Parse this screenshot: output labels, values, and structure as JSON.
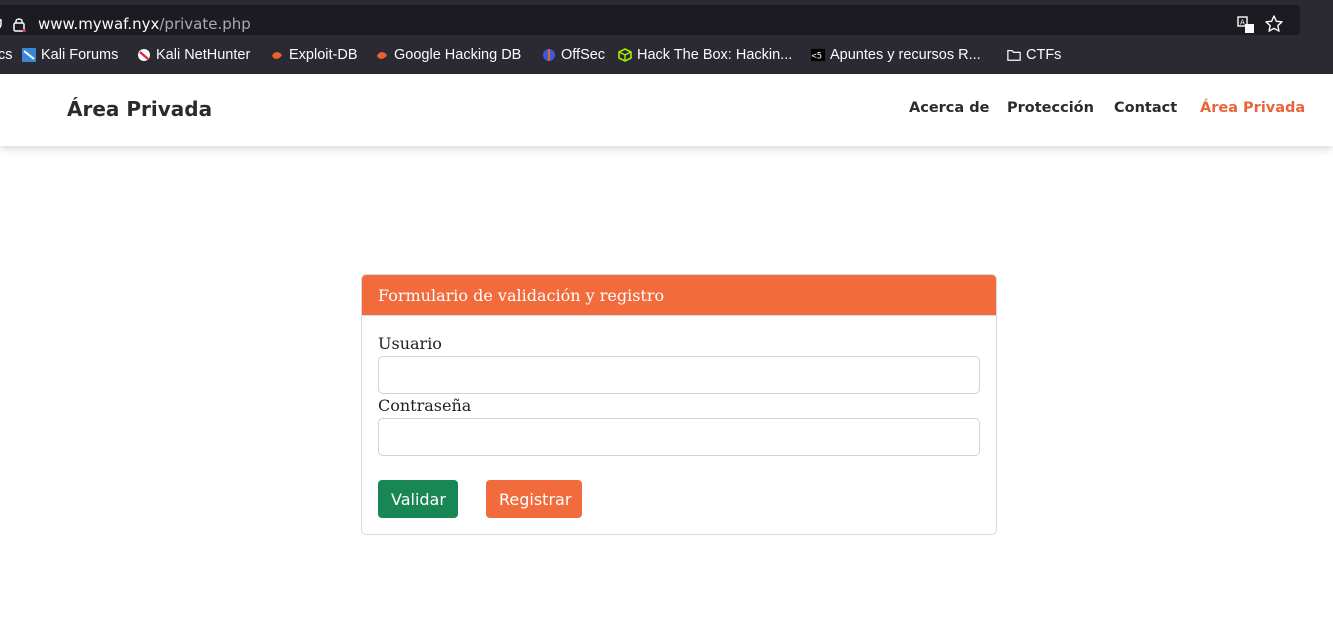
{
  "browser": {
    "url_host": "www.mywaf.nyx",
    "url_path": "/private.php",
    "bookmarks": [
      {
        "label": "Kali Forums",
        "icon": "kali-forums-icon"
      },
      {
        "label": "Kali NetHunter",
        "icon": "kali-nethunter-icon"
      },
      {
        "label": "Exploit-DB",
        "icon": "exploit-db-icon"
      },
      {
        "label": "Google Hacking DB",
        "icon": "ghdb-icon"
      },
      {
        "label": "OffSec",
        "icon": "offsec-icon"
      },
      {
        "label": "Hack The Box: Hackin...",
        "icon": "htb-icon"
      },
      {
        "label": "Apuntes y recursos R...",
        "icon": "apuntes-icon"
      },
      {
        "label": "CTFs",
        "icon": "folder-icon"
      }
    ],
    "bookmark_partial": "cs"
  },
  "site": {
    "brand": "Área Privada",
    "nav": [
      "Acerca de",
      "Protección",
      "Contact",
      "Área Privada"
    ],
    "active_color": "#e9643a"
  },
  "form": {
    "title": "Formulario de validación y registro",
    "user_label": "Usuario",
    "user_value": "",
    "pass_label": "Contraseña",
    "pass_value": "",
    "validate_label": "Validar",
    "register_label": "Registrar",
    "accent": "#f26b3d",
    "success": "#198754"
  }
}
